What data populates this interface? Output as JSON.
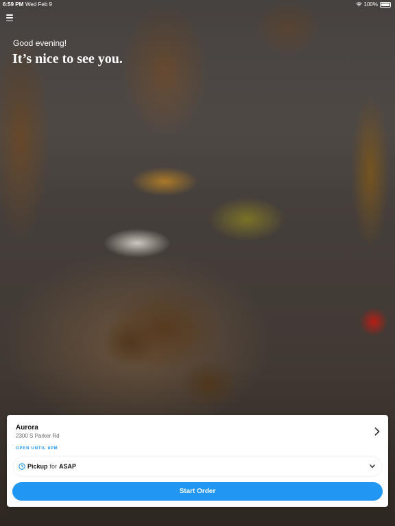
{
  "status_bar": {
    "time": "6:59 PM",
    "date": "Wed Feb 9",
    "battery": "100%"
  },
  "hero": {
    "greeting": "Good evening!",
    "headline": "It’s nice to see you."
  },
  "location": {
    "name": "Aurora",
    "address": "2300 S Parker Rd",
    "hours": "OPEN UNTIL 8PM"
  },
  "order_mode": {
    "mode": "Pickup",
    "connector": "for",
    "time": "ASAP"
  },
  "actions": {
    "start_order": "Start Order"
  },
  "colors": {
    "accent": "#2196f3"
  },
  "icons": {
    "menu": "hamburger-menu-icon",
    "clock": "clock-icon",
    "chevron_right": "chevron-right-icon",
    "chevron_down": "chevron-down-icon"
  }
}
